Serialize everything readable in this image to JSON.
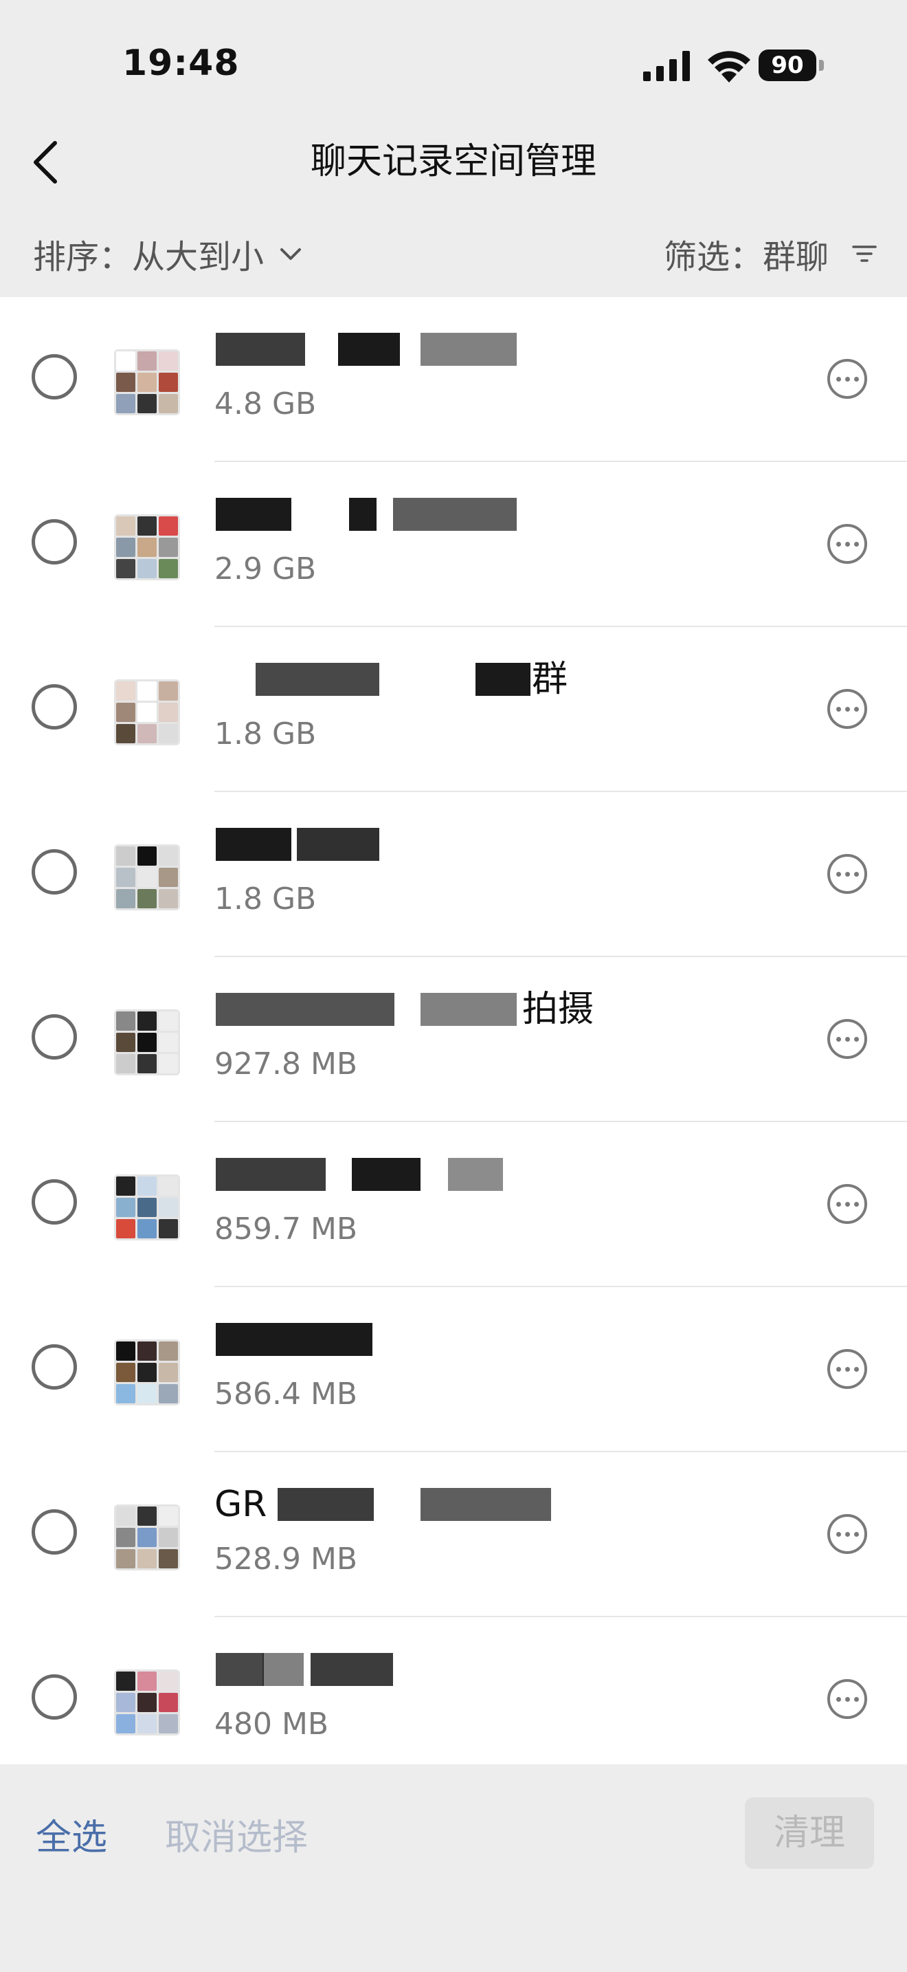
{
  "status_bar": {
    "time": "19:48",
    "battery": "90",
    "icons": [
      "cellular-signal-icon",
      "wifi-icon",
      "battery-icon"
    ]
  },
  "nav": {
    "title": "聊天记录空间管理",
    "back_icon": "chevron-left-icon"
  },
  "toolbar": {
    "sort_label": "排序：",
    "sort_value": "从大到小",
    "filter_label": "筛选：",
    "filter_value": "群聊"
  },
  "chats": [
    {
      "name": "",
      "size": "4.8 GB"
    },
    {
      "name": "",
      "size": "2.9 GB"
    },
    {
      "name": "群",
      "size": "1.8 GB"
    },
    {
      "name": "",
      "size": "1.8 GB"
    },
    {
      "name": "拍摄",
      "size": "927.8 MB"
    },
    {
      "name": "",
      "size": "859.7 MB"
    },
    {
      "name": "",
      "size": "586.4 MB"
    },
    {
      "name": "GR",
      "size": "528.9 MB"
    },
    {
      "name": "",
      "size": "480 MB"
    }
  ],
  "bottom_bar": {
    "select_all": "全选",
    "cancel_selection": "取消选择",
    "clean": "清理"
  }
}
